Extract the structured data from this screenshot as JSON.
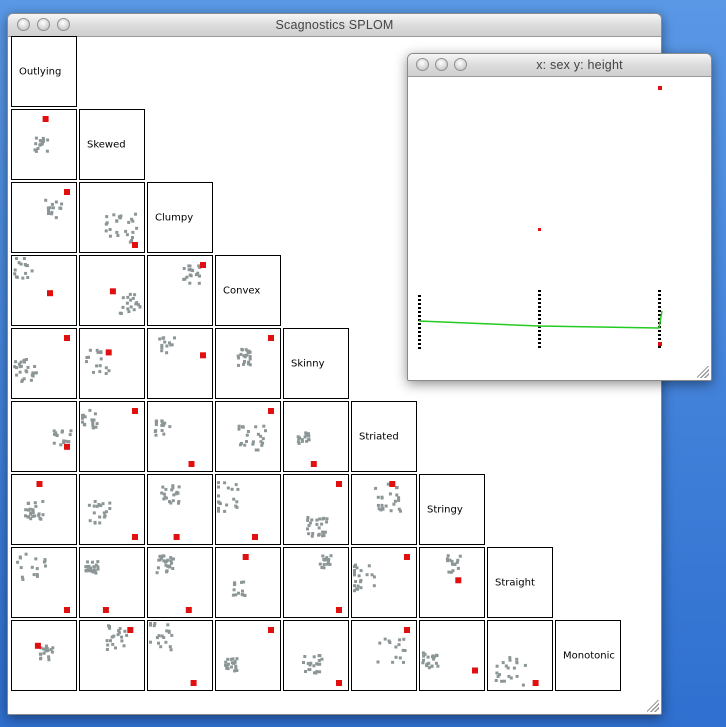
{
  "splom_window": {
    "title": "Scagnostics SPLOM",
    "labels": [
      "Outlying",
      "Skewed",
      "Clumpy",
      "Convex",
      "Skinny",
      "Striated",
      "Stringy",
      "Straight",
      "Monotonic"
    ]
  },
  "plot_window": {
    "title": "x: sex y: height"
  },
  "colors": {
    "desktop": "#3f7fd8",
    "point": "#8c9696",
    "highlight": "#e01010",
    "line": "#22cc22",
    "axis_mark": "#000000"
  }
}
